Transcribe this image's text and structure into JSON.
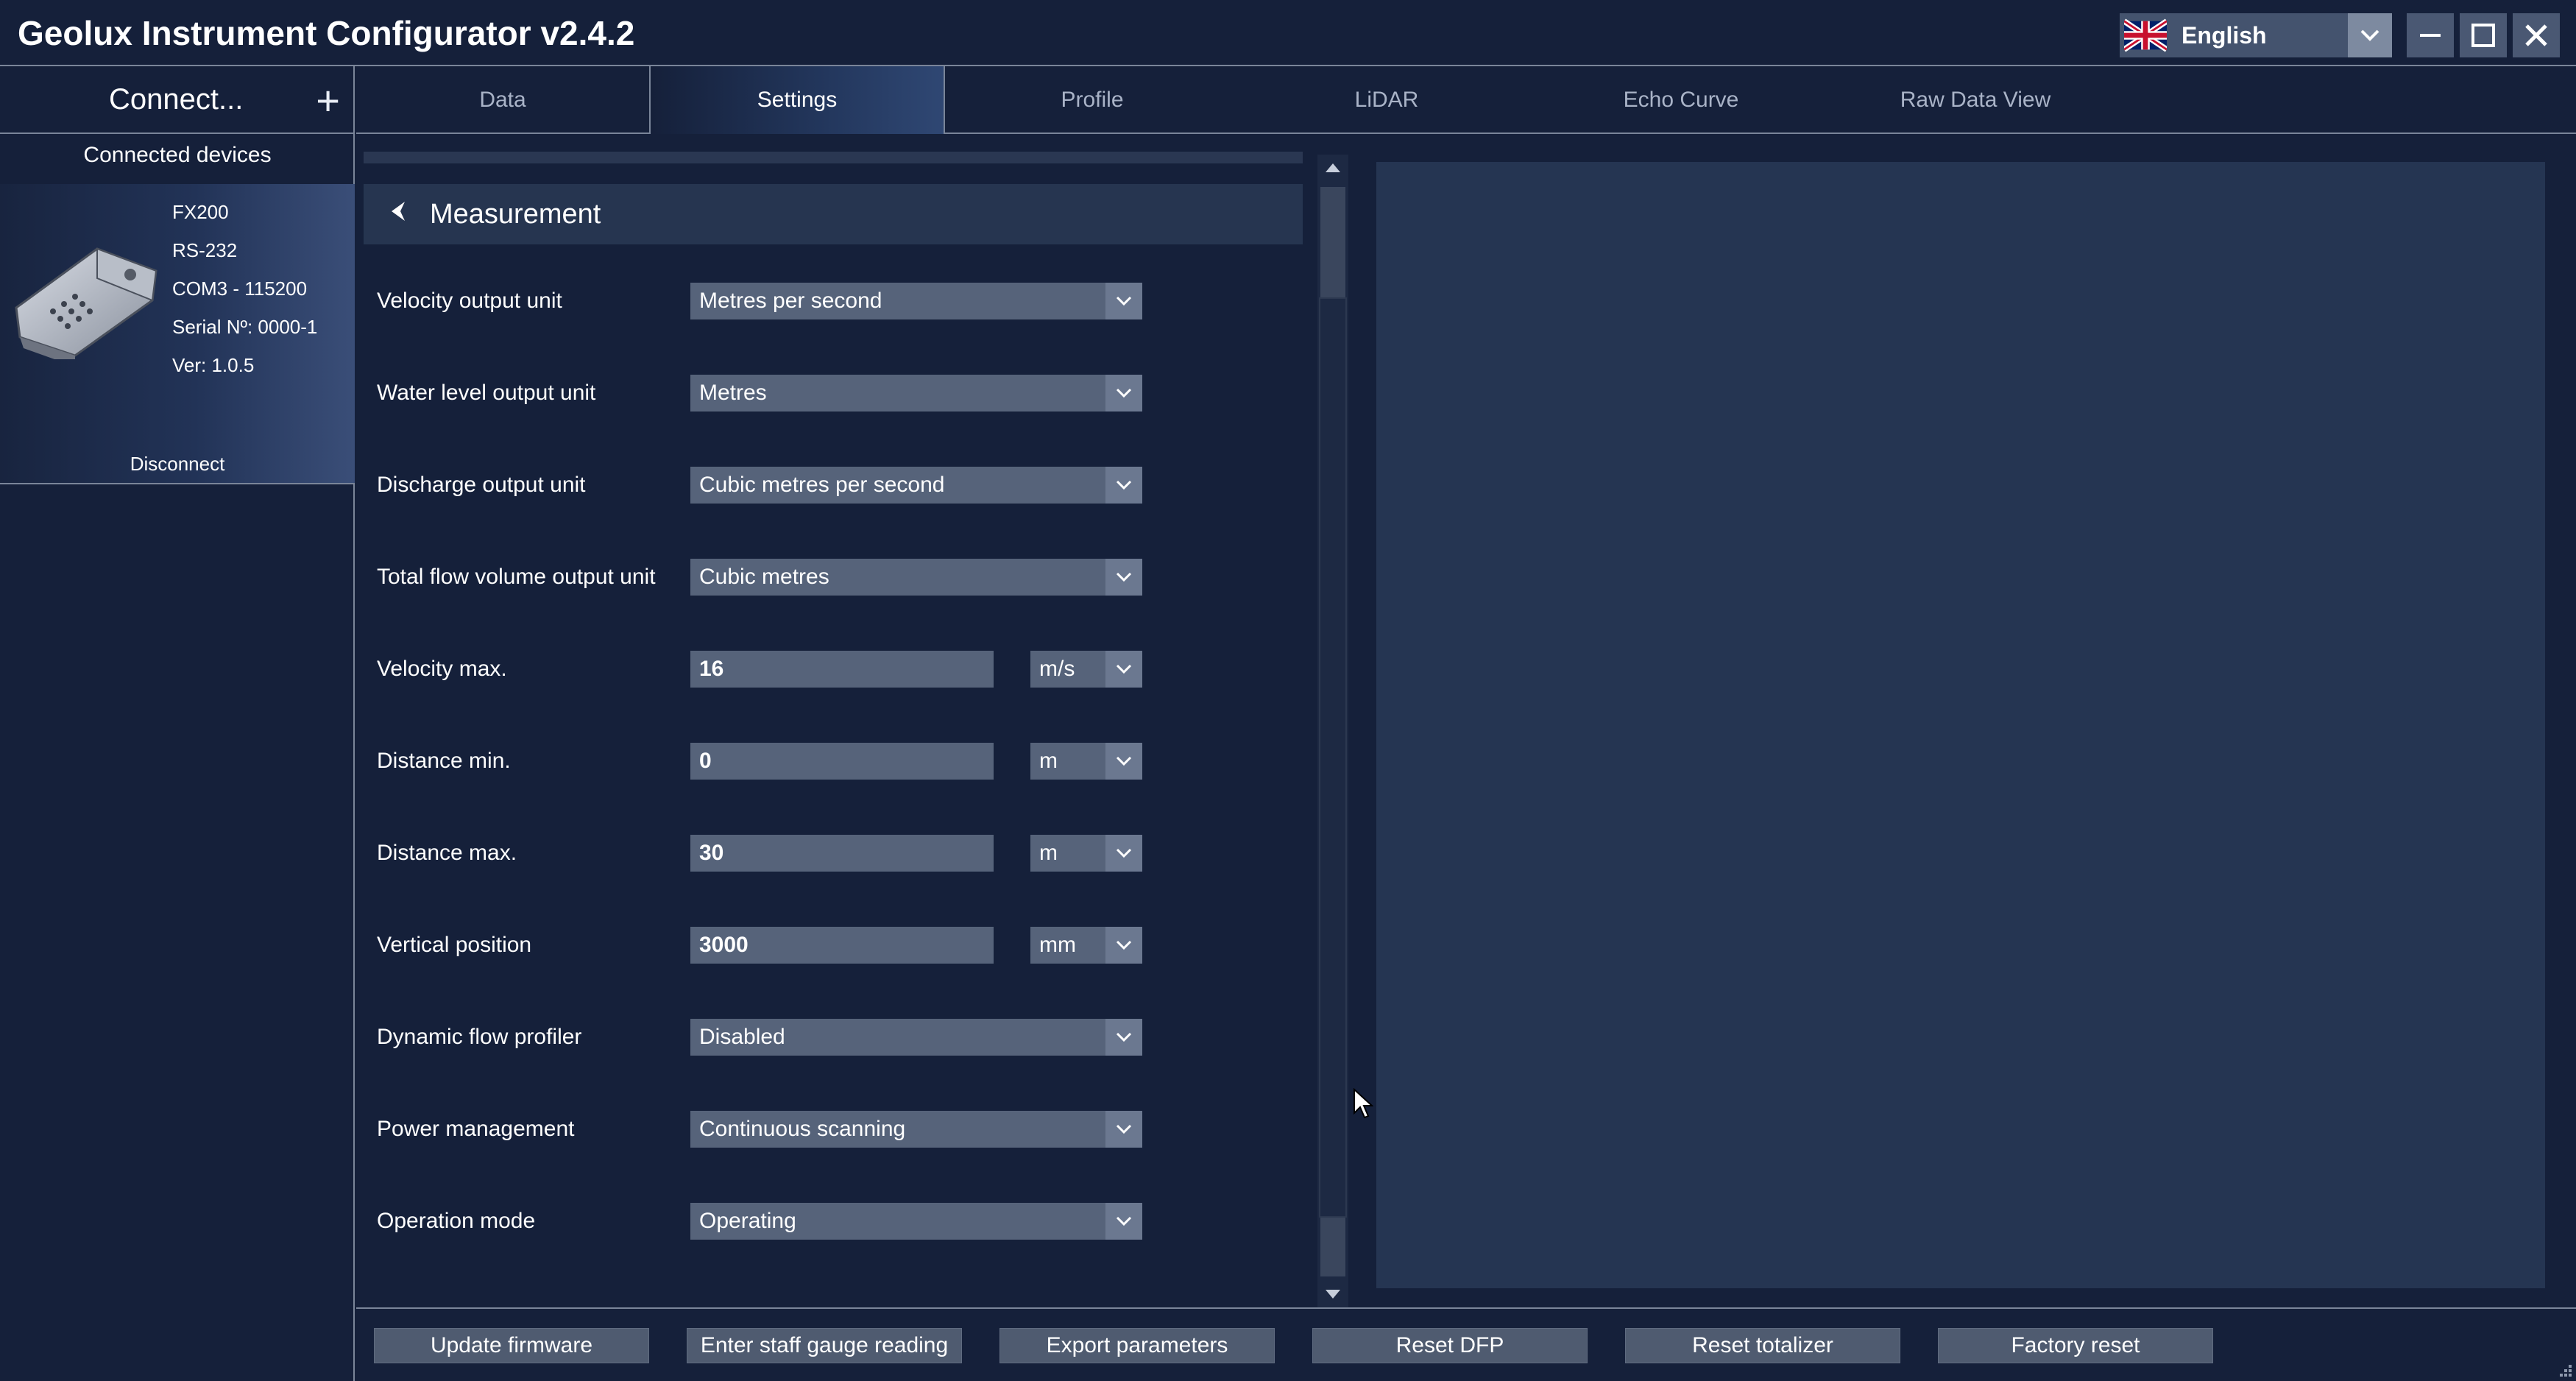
{
  "window": {
    "title": "Geolux Instrument Configurator v2.4.2",
    "language": "English",
    "controls": [
      "minimize-icon",
      "maximize-icon",
      "close-icon"
    ]
  },
  "sidebar": {
    "connect_label": "Connect...",
    "add_label": "+",
    "devices_heading": "Connected devices",
    "device": {
      "model": "FX200",
      "interface": "RS-232",
      "port": "COM3 - 115200",
      "serial": "Serial Nº: 0000-1",
      "version": "Ver:  1.0.5",
      "disconnect_label": "Disconnect"
    }
  },
  "tabs": [
    {
      "label": "Data",
      "active": false
    },
    {
      "label": "Settings",
      "active": true
    },
    {
      "label": "Profile",
      "active": false
    },
    {
      "label": "LiDAR",
      "active": false
    },
    {
      "label": "Echo Curve",
      "active": false
    },
    {
      "label": "Raw Data View",
      "active": false
    }
  ],
  "settings": {
    "section_title": "Measurement",
    "rows": [
      {
        "label": "Velocity output unit",
        "type": "combo",
        "value": "Metres per second"
      },
      {
        "label": "Water level output unit",
        "type": "combo",
        "value": "Metres"
      },
      {
        "label": "Discharge output unit",
        "type": "combo",
        "value": "Cubic metres per second"
      },
      {
        "label": "Total flow volume output unit",
        "type": "combo",
        "value": "Cubic metres"
      },
      {
        "label": "Velocity max.",
        "type": "number",
        "value": "16",
        "unit": "m/s"
      },
      {
        "label": "Distance min.",
        "type": "number",
        "value": "0",
        "unit": "m"
      },
      {
        "label": "Distance max.",
        "type": "number",
        "value": "30",
        "unit": "m"
      },
      {
        "label": "Vertical position",
        "type": "number",
        "value": "3000",
        "unit": "mm"
      },
      {
        "label": "Dynamic flow profiler",
        "type": "combo",
        "value": "Disabled"
      },
      {
        "label": "Power management",
        "type": "combo",
        "value": "Continuous scanning"
      },
      {
        "label": "Operation mode",
        "type": "combo",
        "value": "Operating"
      }
    ]
  },
  "actions": [
    "Update firmware",
    "Enter staff gauge reading",
    "Export parameters",
    "Reset DFP",
    "Reset totalizer",
    "Factory reset"
  ],
  "colors": {
    "background": "#15203a",
    "field": "#56637a",
    "button": "#4f5b70",
    "preview": "#253552",
    "divider": "#7a8599"
  }
}
